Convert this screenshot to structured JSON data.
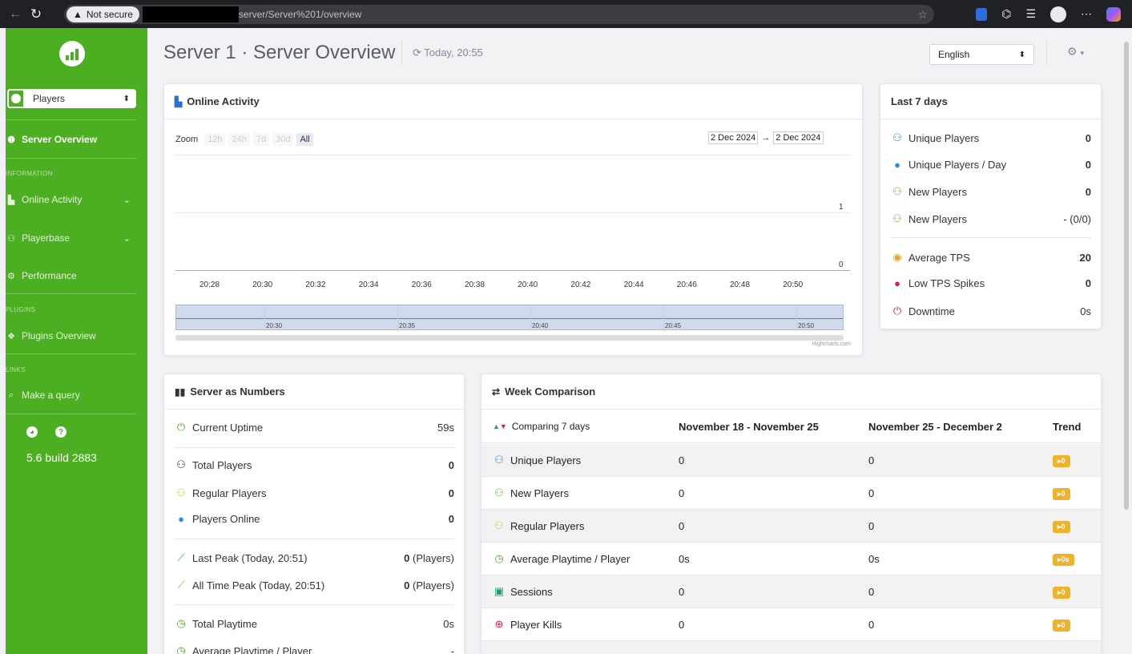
{
  "browser": {
    "security_label": "Not secure",
    "url": "server/Server%201/overview"
  },
  "sidebar": {
    "selector_label": "Players",
    "items": {
      "server_overview": "Server Overview",
      "online_activity": "Online Activity",
      "playerbase": "Playerbase",
      "performance": "Performance",
      "plugins_overview": "Plugins Overview",
      "make_query": "Make a query"
    },
    "headings": {
      "information": "INFORMATION",
      "plugins": "PLUGINS",
      "links": "LINKS"
    },
    "version": "5.6 build 2883"
  },
  "header": {
    "title": "Server 1 · Server Overview",
    "refresh": "Today, 20:55",
    "language": "English"
  },
  "online_activity": {
    "title": "Online Activity",
    "zoom_label": "Zoom",
    "zoom_options": [
      "12h",
      "24h",
      "7d",
      "30d",
      "All"
    ],
    "range_from": "2 Dec 2024",
    "range_arrow": "→",
    "range_to": "2 Dec 2024",
    "credits": "Highcharts.com",
    "navigator_labels": [
      "20:30",
      "20:35",
      "20:40",
      "20:45",
      "20:50"
    ],
    "chart_data": {
      "type": "line",
      "x": [
        "20:28",
        "20:30",
        "20:32",
        "20:34",
        "20:36",
        "20:38",
        "20:40",
        "20:42",
        "20:44",
        "20:46",
        "20:48",
        "20:50"
      ],
      "series": [
        {
          "values": [
            0,
            0,
            0,
            0,
            0,
            0,
            0,
            0,
            0,
            0,
            0,
            0
          ]
        }
      ],
      "y_ticks": [
        "1",
        "0"
      ],
      "ylim": [
        0,
        1
      ],
      "grid": true
    }
  },
  "last7": {
    "title": "Last 7 days",
    "rows": [
      {
        "label": "Unique Players",
        "value": "0"
      },
      {
        "label": "Unique Players / Day",
        "value": "0"
      },
      {
        "label": "New Players",
        "value": "0"
      },
      {
        "label": "New Players",
        "value": "- (0/0)"
      },
      {
        "label": "Average TPS",
        "value": "20"
      },
      {
        "label": "Low TPS Spikes",
        "value": "0"
      },
      {
        "label": "Downtime",
        "value": "0s"
      }
    ]
  },
  "numbers": {
    "title": "Server as Numbers",
    "rows": [
      {
        "label": "Current Uptime",
        "value": "59s"
      },
      {
        "label": "Total Players",
        "value": "0"
      },
      {
        "label": "Regular Players",
        "value": "0"
      },
      {
        "label": "Players Online",
        "value": "0"
      },
      {
        "label": "Last Peak (Today, 20:51)",
        "value": "0",
        "unit": " (Players)"
      },
      {
        "label": "All Time Peak (Today, 20:51)",
        "value": "0",
        "unit": " (Players)"
      },
      {
        "label": "Total Playtime",
        "value": "0s"
      },
      {
        "label": "Average Playtime / Player",
        "value": "-"
      }
    ]
  },
  "week": {
    "title": "Week Comparison",
    "comparing": "Comparing 7 days",
    "col1": "November 18 - November 25",
    "col2": "November 25 - December 2",
    "col3": "Trend",
    "rows": [
      {
        "label": "Unique Players",
        "a": "0",
        "b": "0",
        "trend": "▸0"
      },
      {
        "label": "New Players",
        "a": "0",
        "b": "0",
        "trend": "▸0"
      },
      {
        "label": "Regular Players",
        "a": "0",
        "b": "0",
        "trend": "▸0"
      },
      {
        "label": "Average Playtime / Player",
        "a": "0s",
        "b": "0s",
        "trend": "▸0s"
      },
      {
        "label": "Sessions",
        "a": "0",
        "b": "0",
        "trend": "▸0"
      },
      {
        "label": "Player Kills",
        "a": "0",
        "b": "0",
        "trend": "▸0"
      }
    ]
  },
  "colors": {
    "sidebar": "#4caf21",
    "accent": "#2a6fcf",
    "trend": "#f0b229"
  }
}
